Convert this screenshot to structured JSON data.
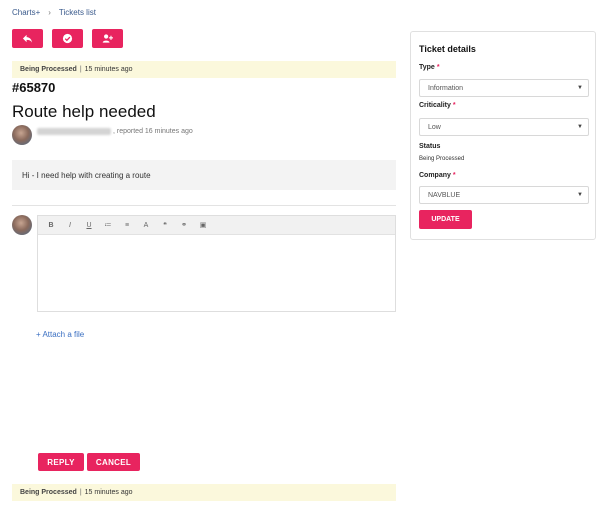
{
  "breadcrumb": {
    "root": "Charts+",
    "current": "Tickets list"
  },
  "toolbar": {
    "buttons": [
      "reply-arrow",
      "check-circle",
      "assign-user"
    ]
  },
  "status": {
    "state": "Being Processed",
    "time": "15 minutes ago"
  },
  "ticket": {
    "number": "#65870",
    "title": "Route help needed",
    "reported": ", reported 16 minutes ago",
    "message": "Hi - I need help with creating  a route"
  },
  "editor": {
    "tools": [
      "B",
      "I",
      "U",
      "≔",
      "≡",
      "A",
      "❝",
      "⚭",
      "▣"
    ]
  },
  "attach_label": "+ Attach a file",
  "actions": {
    "reply": "REPLY",
    "cancel": "CANCEL"
  },
  "details": {
    "title": "Ticket details",
    "type_label": "Type",
    "type_value": "Information",
    "criticality_label": "Criticality",
    "criticality_value": "Low",
    "status_label": "Status",
    "status_value": "Being Processed",
    "company_label": "Company",
    "company_value": "NAVBLUE",
    "update_label": "UPDATE",
    "required_mark": "*"
  },
  "colors": {
    "accent": "#e8245f",
    "status_bg": "#fbf8dc",
    "link": "#3a6fc2"
  }
}
